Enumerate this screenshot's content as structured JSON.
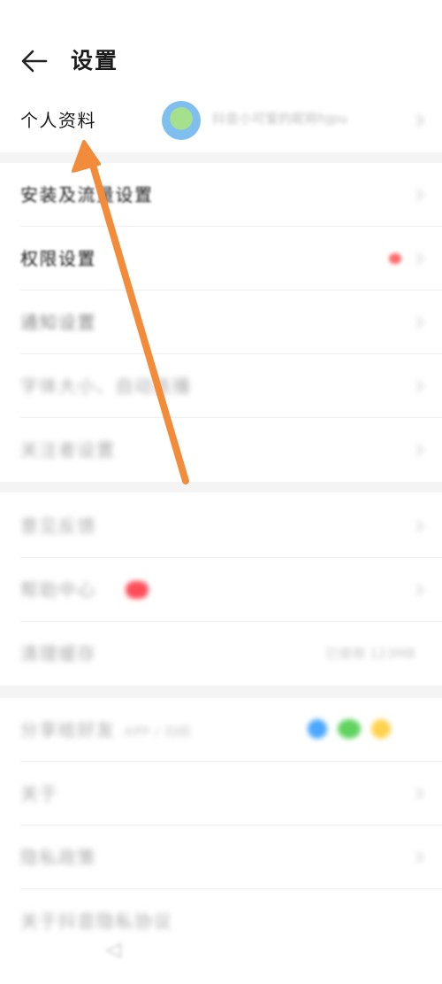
{
  "header": {
    "title": "设置",
    "back_icon": "arrow-left-icon"
  },
  "profile": {
    "label": "个人资料",
    "nickname": "抖音小可爱的昵称hjpu"
  },
  "group1": [
    {
      "label": "安装及流量设置"
    },
    {
      "label": "权限设置",
      "has_red_dot": true
    },
    {
      "label": "通知设置"
    },
    {
      "label": "字体大小、自动连播"
    },
    {
      "label": "关注者设置"
    }
  ],
  "group2": [
    {
      "label": "意见反馈"
    },
    {
      "label": "帮助中心",
      "has_new_badge": true
    },
    {
      "label": "清理缓存",
      "value": "已使用 123MB"
    }
  ],
  "group3": [
    {
      "label": "分享给好友",
      "suffix": "APP / 扫码"
    },
    {
      "label": "关于"
    },
    {
      "label": "隐私政策"
    },
    {
      "label": "关于抖音隐私协议"
    }
  ],
  "colors": {
    "annotation_arrow": "#f28c3a",
    "badge": "#ff4d5a",
    "divider": "#efefef"
  }
}
